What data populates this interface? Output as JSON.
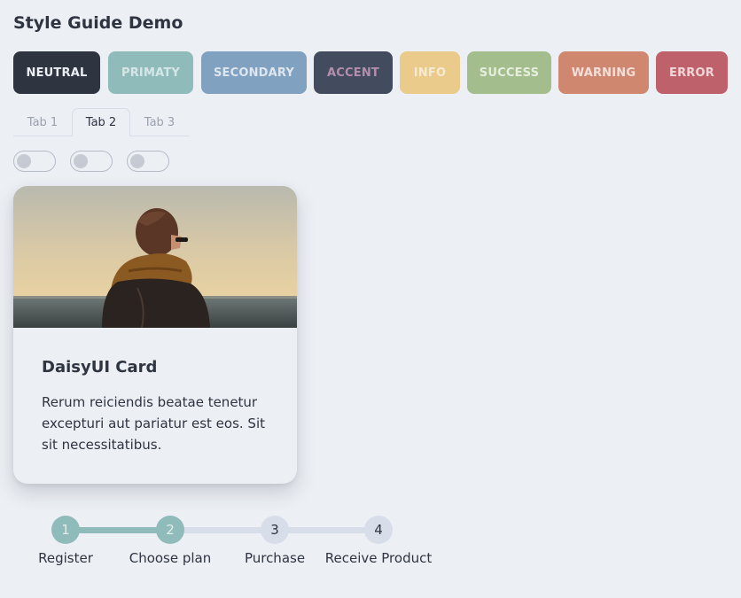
{
  "page": {
    "title": "Style Guide Demo"
  },
  "colors": {
    "neutral": "#2e3440",
    "primary": "#8fbcbb",
    "secondary": "#81a1c1",
    "accent": "#434c5e",
    "info": "#ebcb8b",
    "success": "#a3be8c",
    "warning": "#d08770",
    "error": "#bf616a",
    "base": "#eceff4",
    "step_inactive": "#d8dee9"
  },
  "buttons": [
    {
      "label": "NEUTRAL",
      "variant": "neutral"
    },
    {
      "label": "PRIMATY",
      "variant": "primary"
    },
    {
      "label": "SECONDARY",
      "variant": "secondary"
    },
    {
      "label": "ACCENT",
      "variant": "accent"
    },
    {
      "label": "INFO",
      "variant": "info"
    },
    {
      "label": "SUCCESS",
      "variant": "success"
    },
    {
      "label": "WARNING",
      "variant": "warning"
    },
    {
      "label": "ERROR",
      "variant": "error"
    }
  ],
  "tabs": [
    {
      "label": "Tab 1",
      "active": false
    },
    {
      "label": "Tab 2",
      "active": true
    },
    {
      "label": "Tab 3",
      "active": false
    }
  ],
  "toggles": [
    {
      "checked": false
    },
    {
      "checked": false
    },
    {
      "checked": false
    }
  ],
  "card": {
    "title": "DaisyUI Card",
    "text": "Rerum reiciendis beatae tenetur excepturi aut pariatur est eos. Sit sit necessitatibus.",
    "image_alt": "person-looking-at-sea-photo"
  },
  "steps": [
    {
      "number": "1",
      "label": "Register",
      "done": true
    },
    {
      "number": "2",
      "label": "Choose plan",
      "done": true
    },
    {
      "number": "3",
      "label": "Purchase",
      "done": false
    },
    {
      "number": "4",
      "label": "Receive Product",
      "done": false
    }
  ]
}
